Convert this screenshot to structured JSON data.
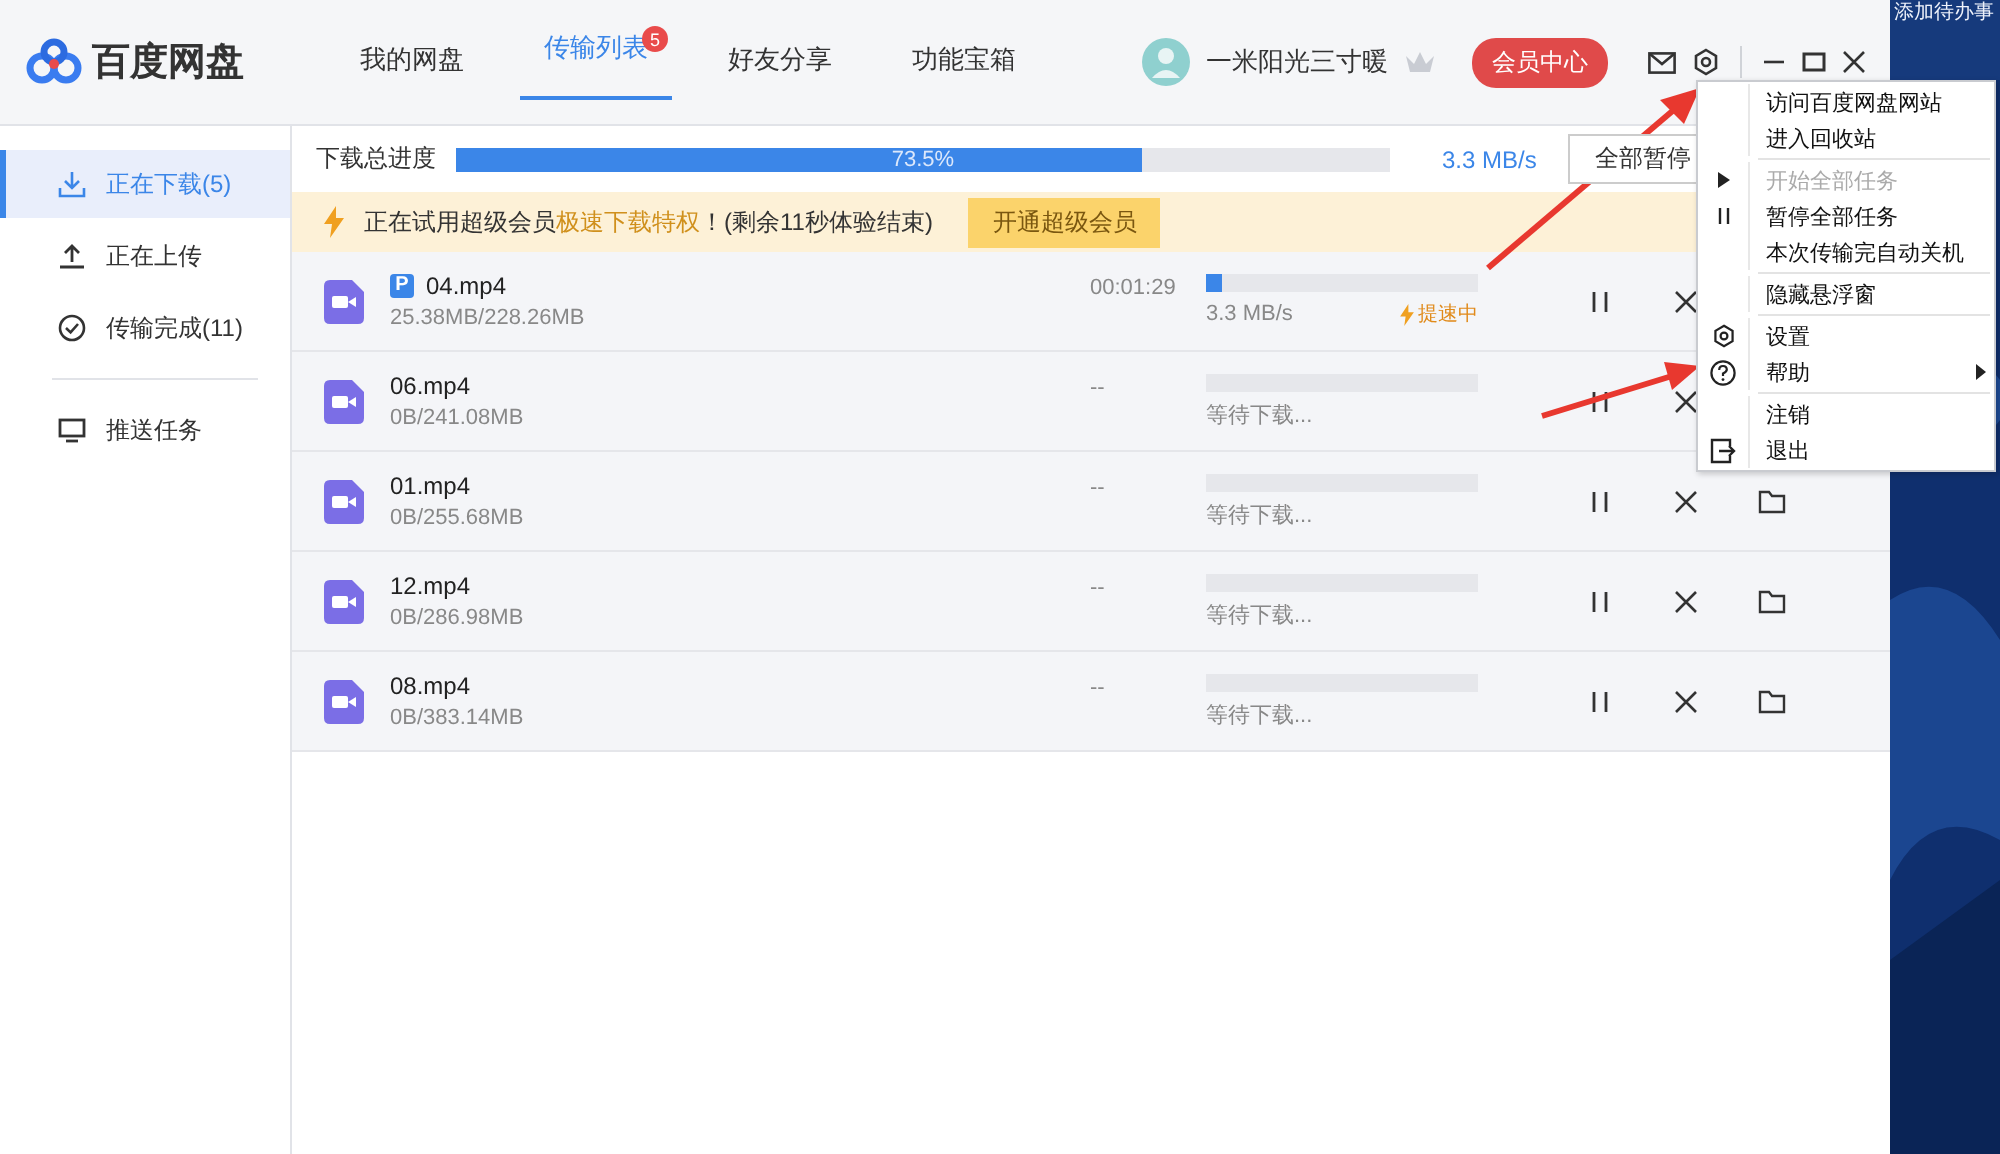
{
  "app": {
    "title": "百度网盘"
  },
  "nav": [
    {
      "label": "我的网盘",
      "selected": false
    },
    {
      "label": "传输列表",
      "selected": true,
      "badge": "5"
    },
    {
      "label": "好友分享",
      "selected": false
    },
    {
      "label": "功能宝箱",
      "selected": false
    }
  ],
  "user": {
    "name": "一米阳光三寸暖",
    "vip_button": "会员中心"
  },
  "sidebar": {
    "items": [
      {
        "label": "正在下载(5)",
        "selected": true
      },
      {
        "label": "正在上传",
        "selected": false
      },
      {
        "label": "传输完成(11)",
        "selected": false
      },
      {
        "label": "推送任务",
        "selected": false
      }
    ]
  },
  "progress": {
    "label": "下载总进度",
    "level": 0.735,
    "reading": "73.5%",
    "speed": "3.3 MB/s",
    "button": "全部暂停"
  },
  "banner": {
    "parts": [
      {
        "text": "正在试用超级会员",
        "highlight": false
      },
      {
        "text": "极速下载特权",
        "highlight": true
      },
      {
        "text": "！(剩余11秒体验结束)",
        "highlight": false
      }
    ],
    "button": "开通超级会员"
  },
  "downloads": [
    {
      "badge": "P",
      "name": "04.mp4",
      "size": "25.38MB/228.26MB",
      "time": "00:01:29",
      "level": 0.06,
      "status": "3.3 MB/s",
      "boost": "提速中",
      "folder_button": false
    },
    {
      "name": "06.mp4",
      "size": "0B/241.08MB",
      "time": "--",
      "level": 0,
      "status": "等待下载...",
      "folder_button": false
    },
    {
      "name": "01.mp4",
      "size": "0B/255.68MB",
      "time": "--",
      "level": 0,
      "status": "等待下载...",
      "folder_button": true
    },
    {
      "name": "12.mp4",
      "size": "0B/286.98MB",
      "time": "--",
      "level": 0,
      "status": "等待下载...",
      "folder_button": true
    },
    {
      "name": "08.mp4",
      "size": "0B/383.14MB",
      "time": "--",
      "level": 0,
      "status": "等待下载...",
      "folder_button": true
    }
  ],
  "menu": [
    {
      "kind": "item",
      "label": "访问百度网盘网站",
      "disabled": false
    },
    {
      "kind": "item",
      "label": "进入回收站",
      "disabled": false
    },
    {
      "kind": "separator"
    },
    {
      "kind": "item",
      "label": "开始全部任务",
      "disabled": true
    },
    {
      "kind": "item",
      "label": "暂停全部任务",
      "disabled": false
    },
    {
      "kind": "item",
      "label": "本次传输完自动关机",
      "disabled": false
    },
    {
      "kind": "separator"
    },
    {
      "kind": "item",
      "label": "隐藏悬浮窗",
      "disabled": false
    },
    {
      "kind": "separator"
    },
    {
      "kind": "item",
      "label": "设置",
      "disabled": false
    },
    {
      "kind": "submenu",
      "label": "帮助",
      "disabled": false
    },
    {
      "kind": "separator"
    },
    {
      "kind": "item",
      "label": "注销",
      "disabled": false
    },
    {
      "kind": "item",
      "label": "退出",
      "disabled": false
    }
  ],
  "desktop": {
    "text": "添加待办事"
  }
}
